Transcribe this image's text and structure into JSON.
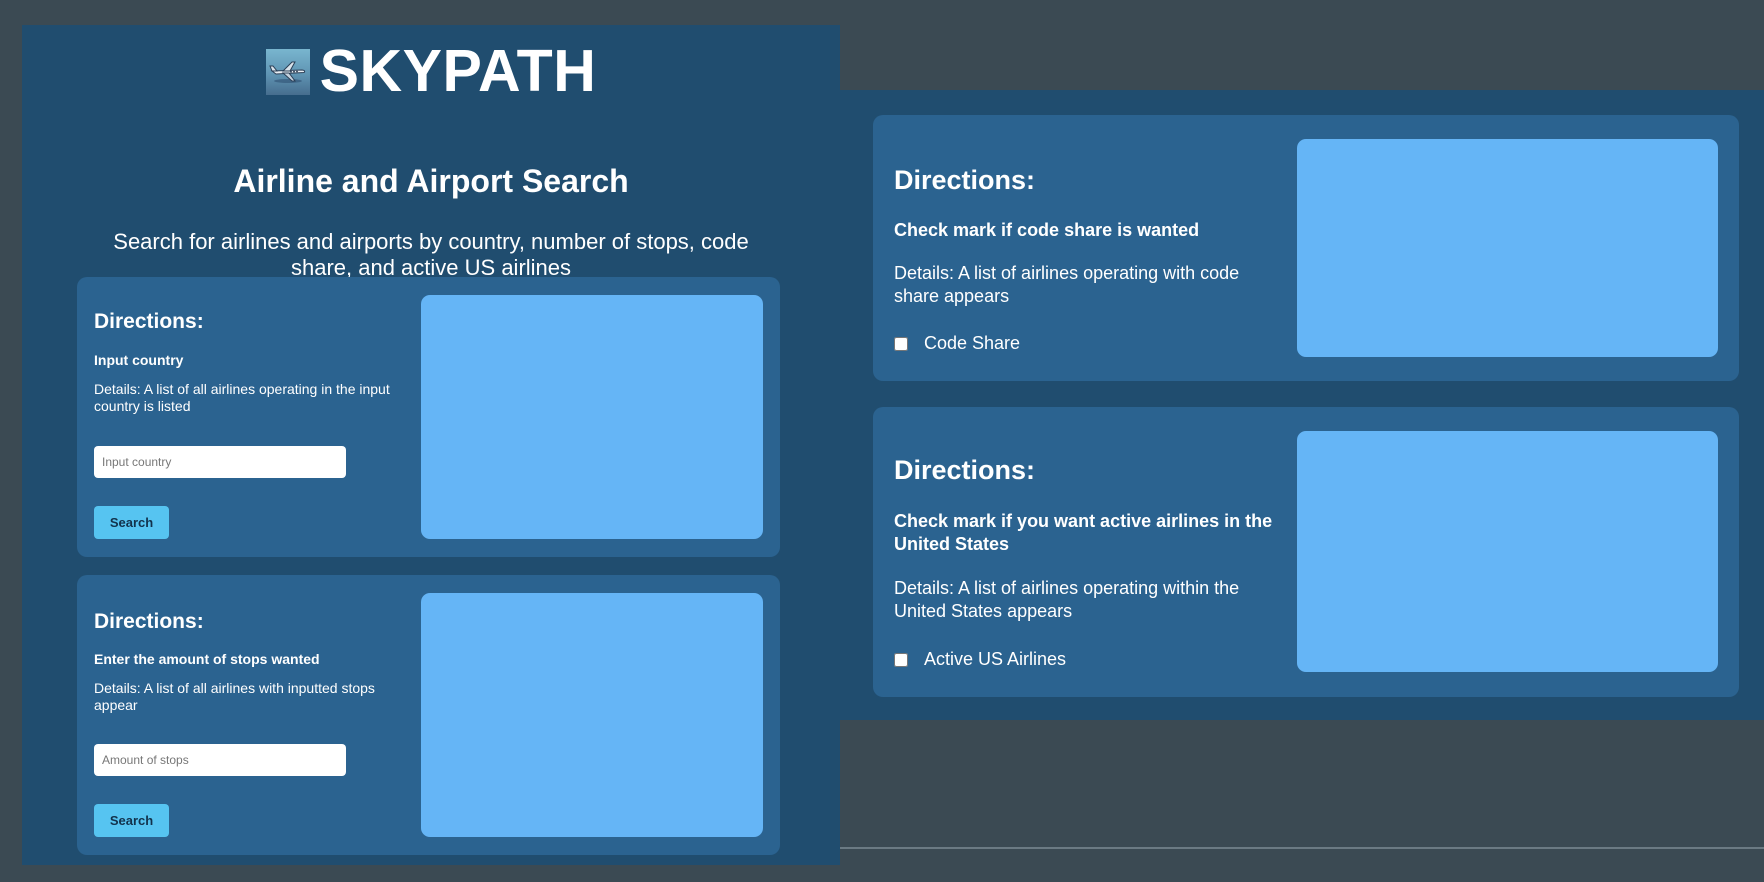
{
  "header": {
    "logo_icon": "airplane-icon",
    "brand": "SKYPATH"
  },
  "page": {
    "title": "Airline and Airport Search",
    "subtitle": "Search for airlines and airports by country, number of stops, code share, and active US airlines"
  },
  "cards": {
    "country": {
      "directions": "Directions:",
      "instruction": "Input country",
      "details": "Details: A list of all airlines operating in the input country is listed",
      "placeholder": "Input country",
      "button": "Search"
    },
    "stops": {
      "directions": "Directions:",
      "instruction": "Enter the amount of stops wanted",
      "details": "Details: A list of all airlines with inputted stops appear",
      "placeholder": "Amount of stops",
      "button": "Search"
    },
    "codeshare": {
      "directions": "Directions:",
      "instruction": "Check mark if code share is wanted",
      "details": "Details: A list of airlines operating with code share appears",
      "checkbox_label": "Code Share",
      "checked": false
    },
    "active_us": {
      "directions": "Directions:",
      "instruction": "Check mark if you want active airlines in the United States",
      "details": "Details: A list of airlines operating within the United States appears",
      "checkbox_label": "Active US Airlines",
      "checked": false
    }
  },
  "colors": {
    "background": "#3b4a53",
    "panel": "#204d6f",
    "card": "#2b6390",
    "result_box": "#65b5f6",
    "button": "#56c4f1"
  }
}
